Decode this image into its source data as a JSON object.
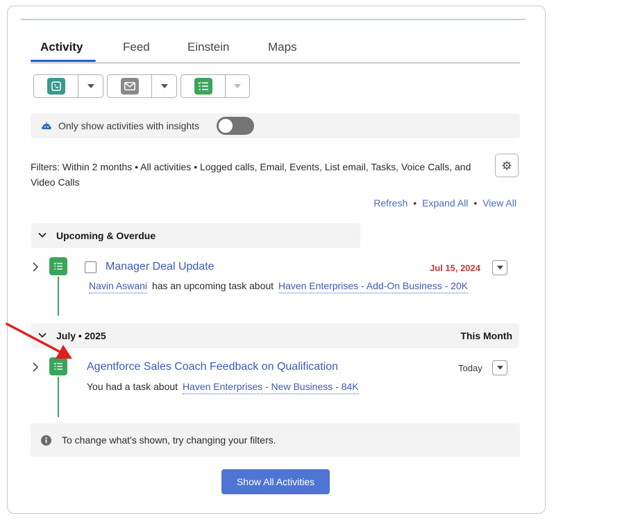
{
  "tabs": [
    {
      "label": "Activity",
      "active": true
    },
    {
      "label": "Feed",
      "active": false
    },
    {
      "label": "Einstein",
      "active": false
    },
    {
      "label": "Maps",
      "active": false
    }
  ],
  "action_buttons": [
    {
      "icon": "phone-icon",
      "color": "#3a9a8c"
    },
    {
      "icon": "email-icon",
      "color": "#8a8a8a"
    },
    {
      "icon": "task-icon",
      "color": "#3aa55a"
    }
  ],
  "insights": {
    "label": "Only show activities with insights",
    "toggle_on": false
  },
  "filters": {
    "text": "Filters: Within 2 months • All activities • Logged calls, Email, Events, List email, Tasks, Voice Calls, and Video Calls"
  },
  "links": {
    "refresh": "Refresh",
    "expand_all": "Expand All",
    "view_all": "View All",
    "separator": "•"
  },
  "sections": {
    "upcoming": {
      "title": "Upcoming & Overdue"
    },
    "july": {
      "title": "July • 2025",
      "right": "This Month"
    }
  },
  "items": {
    "upcoming_task": {
      "subject": "Manager Deal Update",
      "date": "Jul 15, 2024",
      "date_color": "#c23934",
      "person": "Navin Aswani",
      "middle_text": "has an upcoming task about",
      "related": "Haven Enterprises - Add-On Business - 20K"
    },
    "july_task": {
      "subject": "Agentforce Sales Coach Feedback on Qualification",
      "date": "Today",
      "prefix": "You had a task about",
      "related": "Haven Enterprises - New Business - 84K"
    }
  },
  "info_message": "To change what's shown, try changing your filters.",
  "show_all_button": "Show All Activities",
  "accent": "#4e75d4"
}
